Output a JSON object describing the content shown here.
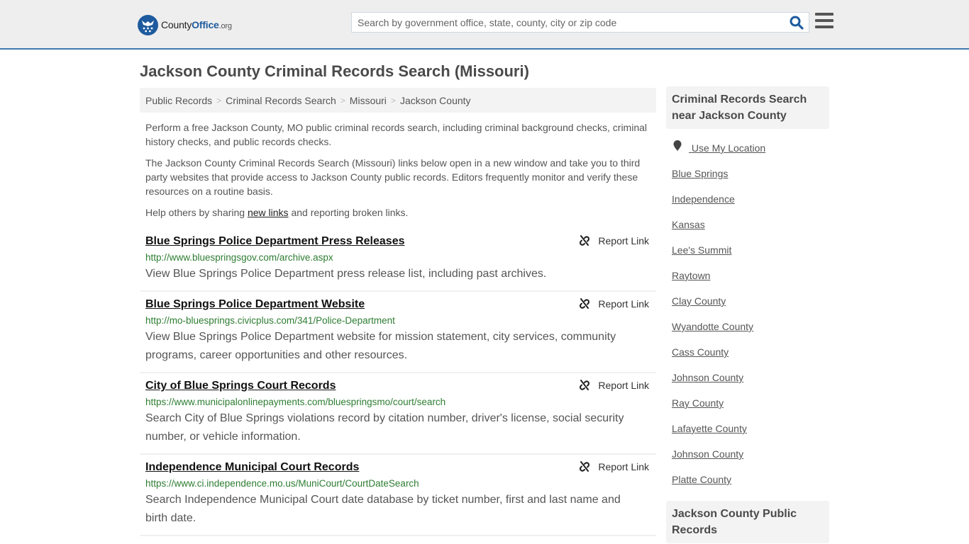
{
  "header": {
    "logo": {
      "name_part1": "County",
      "name_part2": "Office",
      "name_suffix": ".org"
    },
    "search": {
      "placeholder": "Search by government office, state, county, city or zip code",
      "value": ""
    },
    "colors": {
      "brand": "#1e5b9e",
      "accent_border": "#3f7ab0"
    }
  },
  "page": {
    "title": "Jackson County Criminal Records Search (Missouri)",
    "breadcrumb": [
      "Public Records",
      "Criminal Records Search",
      "Missouri",
      "Jackson County"
    ],
    "intro": {
      "p1": "Perform a free Jackson County, MO public criminal records search, including criminal background checks, criminal history checks, and public records checks.",
      "p2": "The Jackson County Criminal Records Search (Missouri) links below open in a new window and take you to third party websites that provide access to Jackson County public records. Editors frequently monitor and verify these resources on a routine basis.",
      "p3_before": "Help others by sharing ",
      "p3_link": "new links",
      "p3_after": " and reporting broken links."
    },
    "report_label": "Report Link",
    "results": [
      {
        "title": "Blue Springs Police Department Press Releases",
        "url": "http://www.bluespringsgov.com/archive.aspx",
        "description": "View Blue Springs Police Department press release list, including past archives."
      },
      {
        "title": "Blue Springs Police Department Website",
        "url": "http://mo-bluesprings.civicplus.com/341/Police-Department",
        "description": "View Blue Springs Police Department website for mission statement, city services, community programs, career opportunities and other resources."
      },
      {
        "title": "City of Blue Springs Court Records",
        "url": "https://www.municipalonlinepayments.com/bluespringsmo/court/search",
        "description": "Search City of Blue Springs violations record by citation number, driver's license, social security number, or vehicle information."
      },
      {
        "title": "Independence Municipal Court Records",
        "url": "https://www.ci.independence.mo.us/MuniCourt/CourtDateSearch",
        "description": "Search Independence Municipal Court date database by ticket number, first and last name and birth date."
      }
    ]
  },
  "sidebar": {
    "nearby_heading": "Criminal Records Search near Jackson County",
    "use_location": "Use My Location",
    "nearby": [
      "Blue Springs",
      "Independence",
      "Kansas",
      "Lee's Summit",
      "Raytown",
      "Clay County",
      "Wyandotte County",
      "Cass County",
      "Johnson County",
      "Ray County",
      "Lafayette County",
      "Johnson County",
      "Platte County"
    ],
    "public_records_heading": "Jackson County Public Records"
  }
}
